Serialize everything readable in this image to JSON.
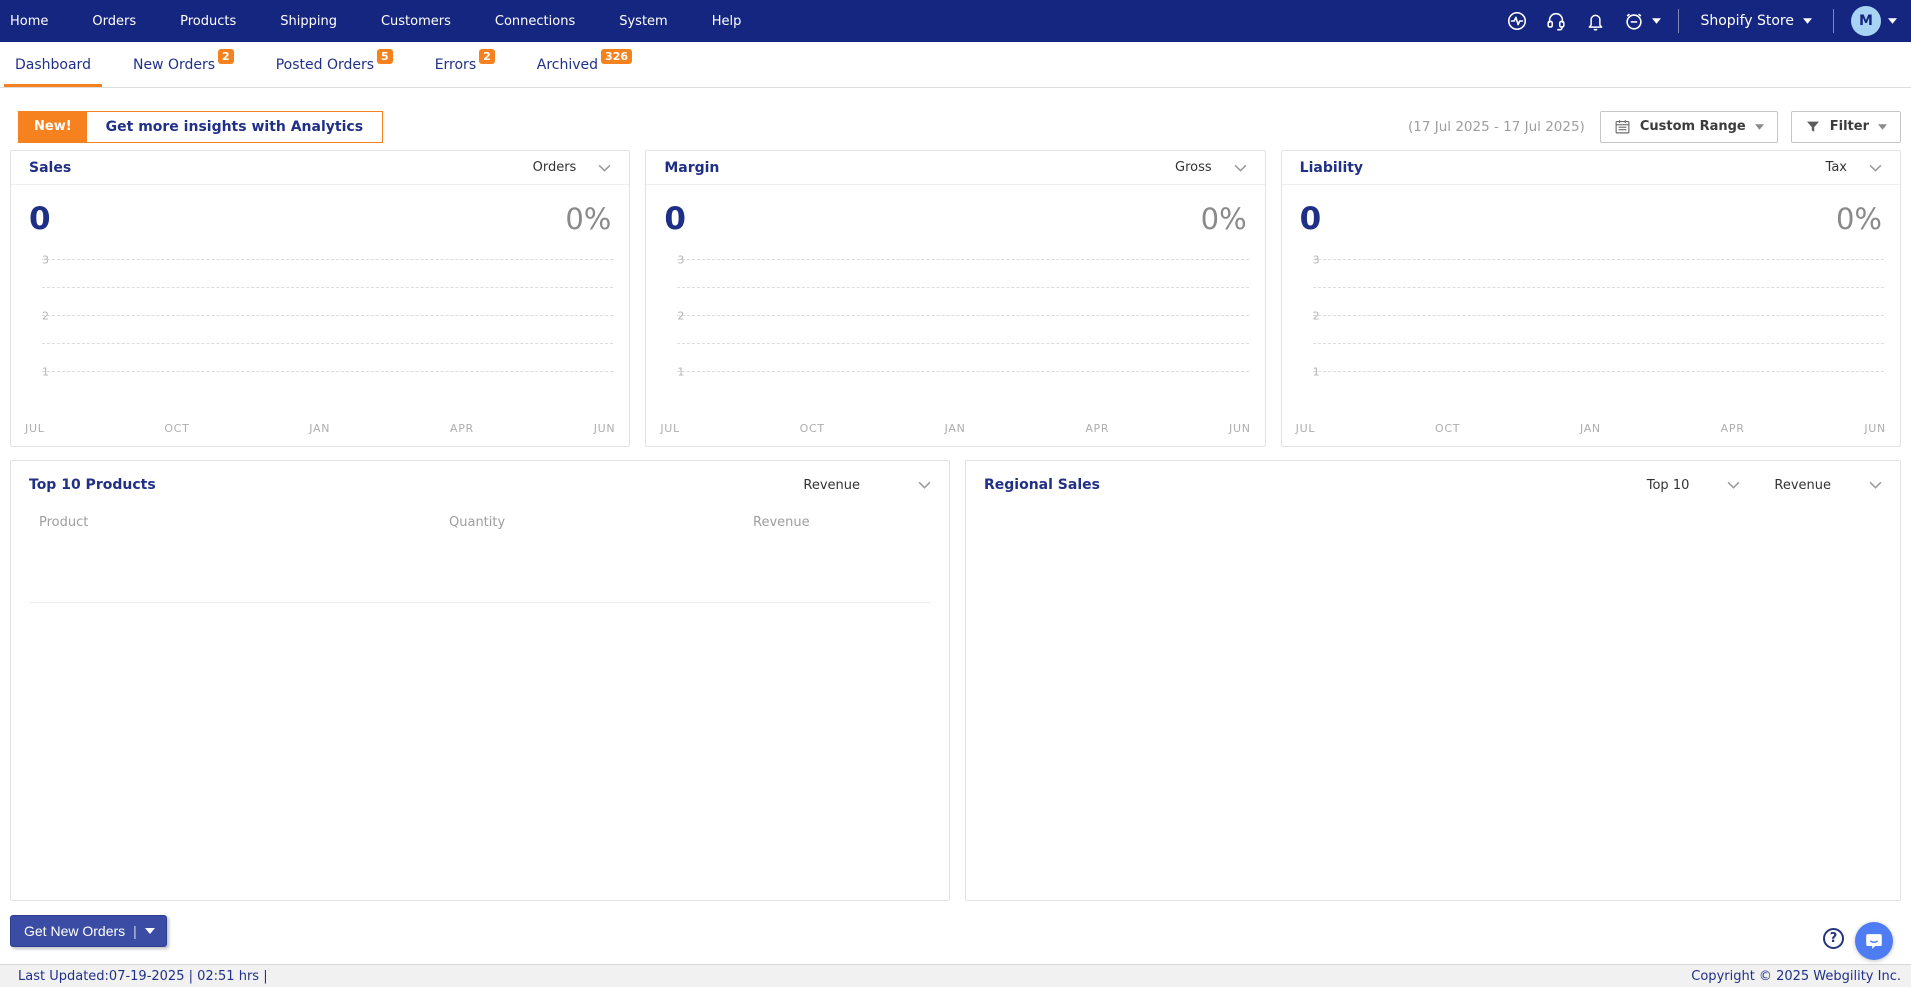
{
  "colors": {
    "navbar_bg": "#152681",
    "accent_orange": "#F5821F",
    "navy_text": "#213087",
    "muted_gray": "#9E9E9E",
    "button_indigo": "#3A4CA3",
    "chat_blue": "#4E7CF2",
    "avatar_bg": "#A9D3F5"
  },
  "navbar": {
    "items": [
      "Home",
      "Orders",
      "Products",
      "Shipping",
      "Customers",
      "Connections",
      "System",
      "Help"
    ],
    "icons": [
      "activity-icon",
      "headset-icon",
      "bell-icon",
      "alarm-icon"
    ],
    "store_selector": "Shopify Store",
    "avatar_initial": "M"
  },
  "tabs": {
    "dashboard": {
      "label": "Dashboard"
    },
    "new_orders": {
      "label": "New Orders",
      "badge": "2"
    },
    "posted_orders": {
      "label": "Posted Orders",
      "badge": "5"
    },
    "errors": {
      "label": "Errors",
      "badge": "2"
    },
    "archived": {
      "label": "Archived",
      "badge": "326"
    }
  },
  "toolbar": {
    "new_badge": "New!",
    "analytics_label": "Get more insights with Analytics",
    "date_range": "(17 Jul 2025 - 17 Jul 2025)",
    "custom_range_label": "Custom Range",
    "filter_label": "Filter"
  },
  "metric_cards": [
    {
      "title": "Sales",
      "dropdown": "Orders",
      "value": "0",
      "percent": "0%"
    },
    {
      "title": "Margin",
      "dropdown": "Gross",
      "value": "0",
      "percent": "0%"
    },
    {
      "title": "Liability",
      "dropdown": "Tax",
      "value": "0",
      "percent": "0%"
    }
  ],
  "chart_data": [
    {
      "type": "line",
      "title": "Sales",
      "x_labels": [
        "JUL",
        "OCT",
        "JAN",
        "APR",
        "JUN"
      ],
      "y_ticks": [
        "3",
        "2",
        "1"
      ],
      "ylim": [
        0,
        3
      ],
      "grid": "dashed",
      "series": [],
      "note": "empty chart - no data plotted"
    },
    {
      "type": "line",
      "title": "Margin",
      "x_labels": [
        "JUL",
        "OCT",
        "JAN",
        "APR",
        "JUN"
      ],
      "y_ticks": [
        "3",
        "2",
        "1"
      ],
      "ylim": [
        0,
        3
      ],
      "grid": "dashed",
      "series": [],
      "note": "empty chart - no data plotted"
    },
    {
      "type": "line",
      "title": "Liability",
      "x_labels": [
        "JUL",
        "OCT",
        "JAN",
        "APR",
        "JUN"
      ],
      "y_ticks": [
        "3",
        "2",
        "1"
      ],
      "ylim": [
        0,
        3
      ],
      "grid": "dashed",
      "series": [],
      "note": "empty chart - no data plotted"
    }
  ],
  "top_products": {
    "title": "Top 10 Products",
    "metric_dropdown": "Revenue",
    "columns": [
      "Product",
      "Quantity",
      "Revenue"
    ],
    "rows": []
  },
  "regional_sales": {
    "title": "Regional Sales",
    "count_dropdown": "Top 10",
    "metric_dropdown": "Revenue"
  },
  "actions": {
    "get_new_orders": "Get New Orders"
  },
  "statusbar": {
    "last_updated": "Last Updated:07-19-2025 | 02:51 hrs |",
    "copyright": "Copyright © 2025 Webgility Inc."
  }
}
